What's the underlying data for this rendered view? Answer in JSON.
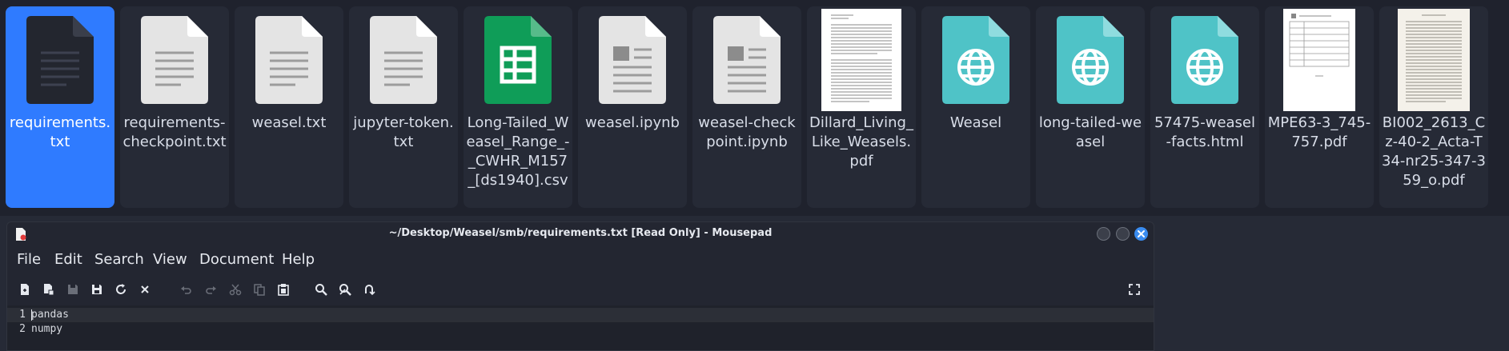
{
  "files": [
    {
      "name": "requirements.txt",
      "icon": "text-file-icon",
      "selected": true
    },
    {
      "name": "requirements-checkpoint.txt",
      "icon": "text-file-icon"
    },
    {
      "name": "weasel.txt",
      "icon": "text-file-icon"
    },
    {
      "name": "jupyter-token.txt",
      "icon": "text-file-icon"
    },
    {
      "name": "Long-Tailed_Weasel_Range_-_CWHR_M157_[ds1940].csv",
      "icon": "spreadsheet-icon"
    },
    {
      "name": "weasel.ipynb",
      "icon": "notebook-file-icon"
    },
    {
      "name": "weasel-checkpoint.ipynb",
      "icon": "notebook-file-icon"
    },
    {
      "name": "Dillard_Living_Like_Weasels.pdf",
      "icon": "pdf-thumbnail"
    },
    {
      "name": "Weasel",
      "icon": "html-file-icon"
    },
    {
      "name": "long-tailed-weasel",
      "icon": "html-file-icon"
    },
    {
      "name": "57475-weasel-facts.html",
      "icon": "html-file-icon"
    },
    {
      "name": "MPE63-3_745-757.pdf",
      "icon": "pdf-thumbnail"
    },
    {
      "name": "BI002_2613_Cz-40-2_Acta-T34-nr25-347-359_o.pdf",
      "icon": "pdf-thumbnail"
    }
  ],
  "window": {
    "title": "~/Desktop/Weasel/smb/requirements.txt [Read Only] - Mousepad"
  },
  "menu": [
    "File",
    "Edit",
    "Search",
    "View",
    "Document",
    "Help"
  ],
  "toolbar": [
    "new-document-icon",
    "new-window-icon",
    "save-icon",
    "save-as-icon",
    "reload-icon",
    "close-icon",
    "undo-icon",
    "redo-icon",
    "cut-icon",
    "copy-icon",
    "paste-icon",
    "find-icon",
    "find-replace-icon",
    "go-to-line-icon",
    "fullscreen-icon"
  ],
  "editor": {
    "lines": [
      {
        "number": "1",
        "text": "pandas"
      },
      {
        "number": "2",
        "text": "numpy"
      }
    ]
  },
  "colors": {
    "selection": "#2f7bff",
    "spreadsheet": "#0f9d58",
    "html": "#4fc3c7",
    "close_button": "#3a8cf0"
  }
}
